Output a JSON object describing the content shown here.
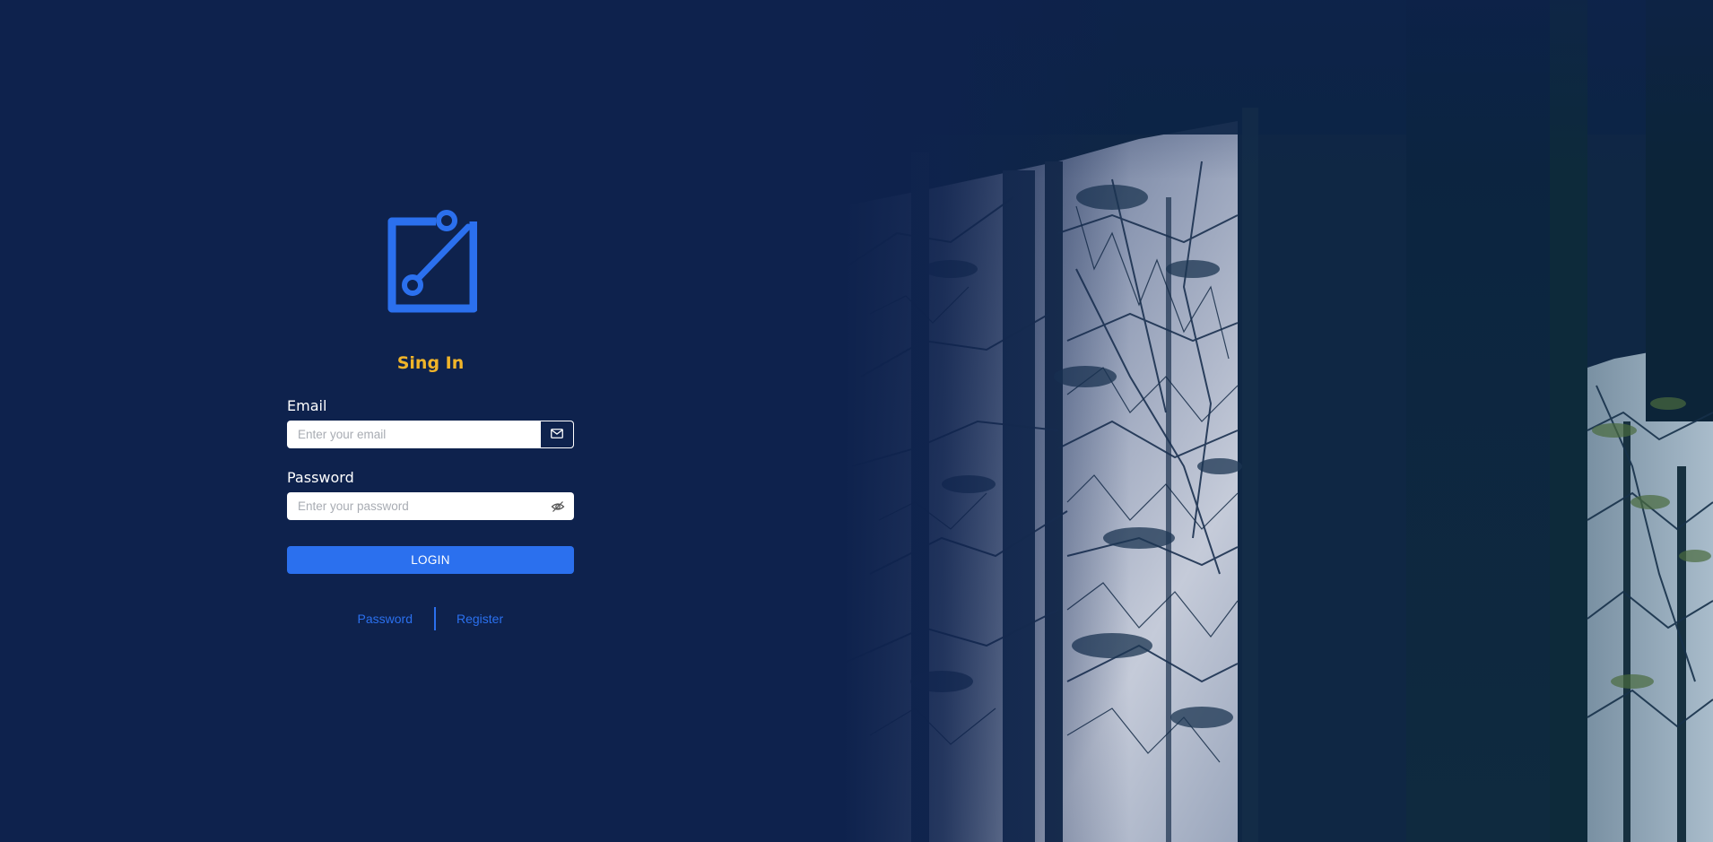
{
  "colors": {
    "background": "#0e224d",
    "accent": "#2b70ee",
    "title": "#f0b429"
  },
  "logo": {
    "icon": "edit-square-icon"
  },
  "form": {
    "title": "Sing In",
    "email": {
      "label": "Email",
      "placeholder": "Enter your email",
      "value": "",
      "icon": "envelope-icon"
    },
    "password": {
      "label": "Password",
      "placeholder": "Enter your password",
      "value": "",
      "icon": "eye-slash-icon"
    },
    "login_button": "LOGIN"
  },
  "links": {
    "password": "Password",
    "register": "Register"
  }
}
